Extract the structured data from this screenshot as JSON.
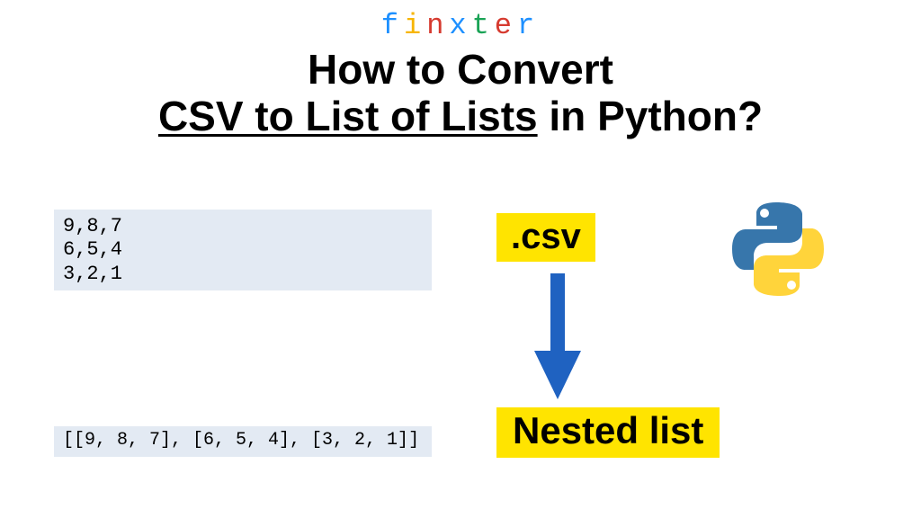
{
  "brand": {
    "letters": [
      {
        "ch": "f",
        "color": "#1e90ff"
      },
      {
        "ch": "i",
        "color": "#f7b500"
      },
      {
        "ch": "n",
        "color": "#d63a2f"
      },
      {
        "ch": "x",
        "color": "#1e90ff"
      },
      {
        "ch": "t",
        "color": "#1aa356"
      },
      {
        "ch": "e",
        "color": "#d63a2f"
      },
      {
        "ch": "r",
        "color": "#1e90ff"
      }
    ]
  },
  "title": {
    "line1": "How to Convert",
    "underlined": "CSV to List of Lists",
    "tail": " in Python?"
  },
  "csv": {
    "content": "9,8,7\n6,5,4\n3,2,1",
    "label": ".csv"
  },
  "nested": {
    "content": "[[9, 8, 7], [6, 5, 4], [3, 2, 1]]",
    "label": "Nested list"
  },
  "arrow": {
    "color": "#1f62c1"
  },
  "python_logo": {
    "blue": "#3776ab",
    "yellow": "#ffd43b"
  }
}
